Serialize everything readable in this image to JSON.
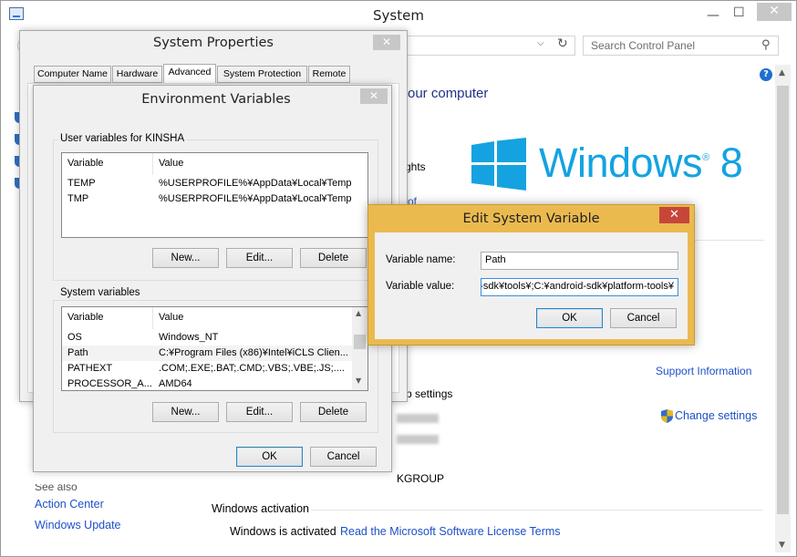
{
  "system_window": {
    "title": "System",
    "close_glyph": "✕",
    "search_placeholder": "Search Control Panel",
    "heading_partial": "our computer",
    "text_partial_rights": "ghts",
    "link_partial_of": "of",
    "windows_logo_text": "Windows",
    "windows_version": "8",
    "support_link": "Support Information",
    "settings_partial": "p settings",
    "change_settings_link": "Change settings",
    "workgroup_partial": "KGROUP",
    "see_also": "See also",
    "action_center_link": "Action Center",
    "windows_update_link": "Windows Update",
    "windows_activation_label": "Windows activation",
    "activation_status": "Windows is activated",
    "license_link": "Read the Microsoft Software License Terms",
    "brand_color": "#14a3e0"
  },
  "system_properties": {
    "title": "System Properties",
    "tabs": [
      "Computer Name",
      "Hardware",
      "Advanced",
      "System Protection",
      "Remote"
    ],
    "active_tab": "Advanced"
  },
  "environment_variables": {
    "title": "Environment Variables",
    "user_group_label": "User variables for KINSHA",
    "columns": [
      "Variable",
      "Value"
    ],
    "user_vars": [
      {
        "name": "TEMP",
        "value": "%USERPROFILE%¥AppData¥Local¥Temp"
      },
      {
        "name": "TMP",
        "value": "%USERPROFILE%¥AppData¥Local¥Temp"
      }
    ],
    "system_group_label": "System variables",
    "system_vars": [
      {
        "name": "OS",
        "value": "Windows_NT"
      },
      {
        "name": "Path",
        "value": "C:¥Program Files (x86)¥Intel¥iCLS Clien..."
      },
      {
        "name": "PATHEXT",
        "value": ".COM;.EXE;.BAT;.CMD;.VBS;.VBE;.JS;...."
      },
      {
        "name": "PROCESSOR_A...",
        "value": "AMD64"
      }
    ],
    "buttons": {
      "new": "New...",
      "edit": "Edit...",
      "delete": "Delete"
    },
    "ok": "OK",
    "cancel": "Cancel"
  },
  "edit_system_variable": {
    "title": "Edit System Variable",
    "name_label": "Variable name:",
    "name_value": "Path",
    "value_label": "Variable value:",
    "value_value": "-sdk¥tools¥;C:¥android-sdk¥platform-tools¥",
    "ok": "OK",
    "cancel": "Cancel",
    "frame_color": "#ebba4f"
  }
}
